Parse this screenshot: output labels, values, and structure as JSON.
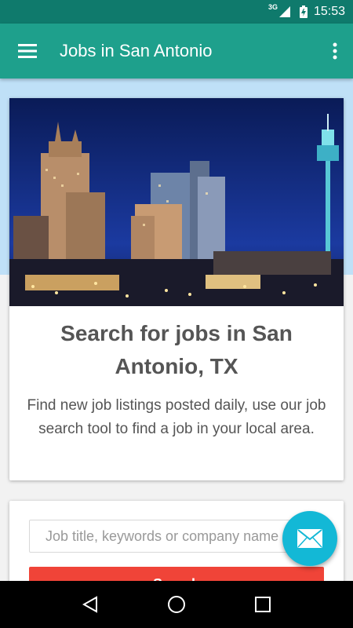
{
  "status_bar": {
    "network": "3G",
    "time": "15:53"
  },
  "app_bar": {
    "title": "Jobs in San Antonio"
  },
  "hero": {
    "title": "Search for jobs in San Antonio, TX",
    "description": "Find new job listings posted daily, use our job search tool to find a job in your local area."
  },
  "search": {
    "placeholder": "Job title, keywords or company name",
    "button_label": "Search"
  },
  "icons": {
    "menu": "hamburger-menu-icon",
    "overflow": "vertical-dots-icon",
    "fab": "envelope-icon",
    "nav_back": "triangle-back-icon",
    "nav_home": "circle-home-icon",
    "nav_recents": "square-recents-icon"
  },
  "colors": {
    "status_bar": "#0f7a6c",
    "app_bar": "#1ea08c",
    "accent_button": "#f04438",
    "fab": "#13b8d6",
    "band": "#bfe0f7"
  }
}
